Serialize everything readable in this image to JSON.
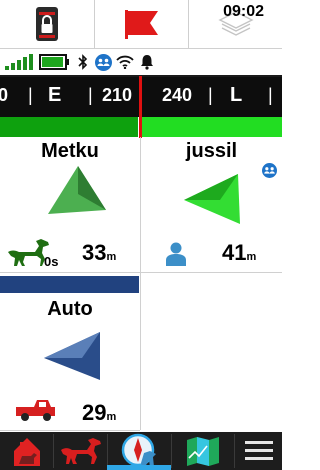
{
  "toolbar": {
    "items": [
      {
        "name": "lock-icon",
        "label": "Lock"
      },
      {
        "name": "flag-icon",
        "label": "Mark"
      },
      {
        "name": "map-layers-icon",
        "label": "Layers"
      }
    ]
  },
  "status": {
    "signal_bars": 5,
    "battery_level": 0.85,
    "time": "09:02",
    "icons": [
      "signal-icon",
      "battery-icon",
      "bluetooth-icon",
      "group-icon",
      "wifi-icon",
      "bell-icon"
    ]
  },
  "compass": {
    "labels": [
      "0",
      "E",
      "210",
      "240",
      "L"
    ]
  },
  "colors": {
    "accent_green": "#0ea10e",
    "needle_red": "#e01010",
    "selected_blue": "#2fa7e6",
    "dog_arrow": "#4caf50",
    "person_arrow": "#33dd33",
    "car_arrow": "#2a4d8a"
  },
  "tracks": [
    {
      "id": "metku",
      "name": "Metku",
      "distance": "33",
      "unit": "m",
      "age": "0s",
      "icon": "dog-icon",
      "pointer": "arrow-icon"
    },
    {
      "id": "jussil",
      "name": "jussil",
      "distance": "41",
      "unit": "m",
      "icon": "person-icon",
      "badge": "group-icon",
      "pointer": "arrow-icon"
    },
    {
      "id": "auto",
      "name": "Auto",
      "distance": "29",
      "unit": "m",
      "icon": "truck-icon",
      "pointer": "arrow-icon"
    }
  ],
  "bottom_nav": {
    "items": [
      "home-icon",
      "dog-tracking-icon",
      "compass-dog-icon",
      "map-icon",
      "menu-icon"
    ],
    "selected": 2
  }
}
